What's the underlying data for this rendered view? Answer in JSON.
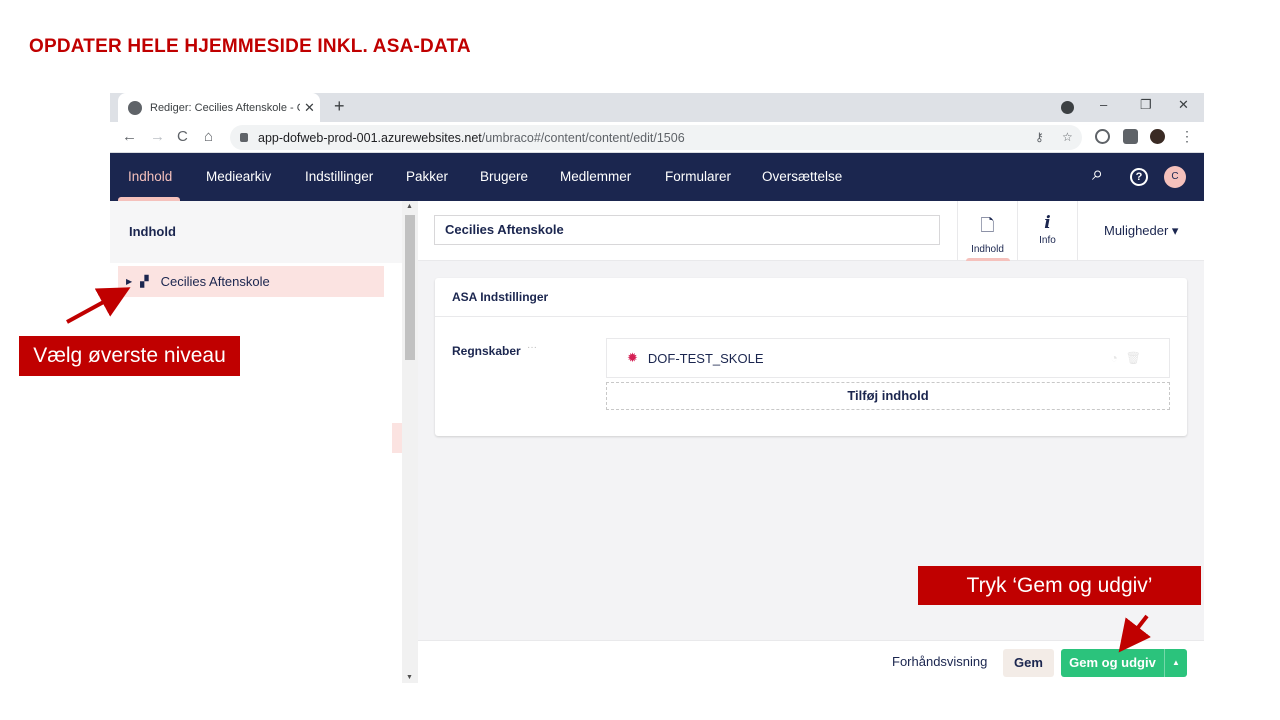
{
  "slide": {
    "title": "OPDATER HELE HJEMMESIDE INKL. ASA-DATA"
  },
  "browser": {
    "tab_title": "Rediger: Cecilies Aftenskole - Co",
    "tab_close": "✕",
    "new_tab": "+",
    "window_controls": {
      "minimize": "–",
      "restore": "❐",
      "close": "✕"
    },
    "nav": {
      "back": "←",
      "forward": "→",
      "reload": "C",
      "home": "⌂"
    },
    "url_host": "app-dofweb-prod-001.azurewebsites.net",
    "url_path": "/umbraco#/content/content/edit/1506",
    "omnibox_icons": {
      "key": "⚷",
      "star": "☆"
    },
    "menu": "⋮"
  },
  "umbraco": {
    "sections": [
      {
        "label": "Indhold",
        "active": true
      },
      {
        "label": "Mediearkiv"
      },
      {
        "label": "Indstillinger"
      },
      {
        "label": "Pakker"
      },
      {
        "label": "Brugere"
      },
      {
        "label": "Medlemmer"
      },
      {
        "label": "Formularer"
      },
      {
        "label": "Oversættelse"
      }
    ],
    "header_icons": {
      "search": "⌕",
      "help": "?"
    },
    "user_initial": "C",
    "sidebar": {
      "title": "Indhold",
      "tree": [
        {
          "label": "Cecilies Aftenskole"
        }
      ]
    },
    "editor": {
      "node_name": "Cecilies Aftenskole",
      "apps": [
        {
          "label": "Indhold",
          "icon": "🗋",
          "active": true
        },
        {
          "label": "Info",
          "icon": "i"
        }
      ],
      "options_label": "Muligheder ▾",
      "group": {
        "title": "ASA Indstillinger",
        "property_label": "Regnskaber",
        "property_dots": "···",
        "items": [
          {
            "label": "DOF-TEST_SKOLE"
          }
        ],
        "add_label": "Tilføj indhold"
      }
    },
    "footer": {
      "preview": "Forhåndsvisning",
      "save": "Gem",
      "publish": "Gem og udgiv",
      "publish_caret": "▲"
    }
  },
  "callouts": {
    "left": "Vælg øverste niveau",
    "right": "Tryk ‘Gem og udgiv’"
  },
  "colors": {
    "accent_red": "#c00000",
    "umbraco_navy": "#1b264f",
    "active_pink": "#f5c1bc",
    "publish_green": "#2bc37c"
  }
}
